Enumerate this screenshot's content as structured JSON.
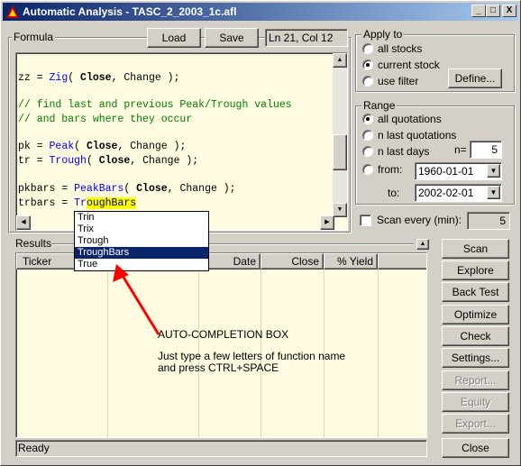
{
  "window": {
    "title": "Automatic Analysis - TASC_2_2003_1c.afl",
    "minimize": "_",
    "maximize": "□",
    "close": "X"
  },
  "formula": {
    "label": "Formula",
    "load_label": "Load",
    "save_label": "Save",
    "position": "Ln 21, Col 12"
  },
  "code": {
    "line1_pre": "zz = ",
    "line1_fn": "Zig",
    "line1_mid": "( ",
    "line1_arg1": "Close",
    "line1_post": ", Change );",
    "comment1": "// find last and previous Peak/Trough values",
    "comment2": "// and bars where they occur",
    "line4_pre": "pk = ",
    "line4_fn": "Peak",
    "line4_mid": "( ",
    "line4_arg1": "Close",
    "line4_post": ", Change );",
    "line5_pre": "tr = ",
    "line5_fn": "Trough",
    "line5_mid": "( ",
    "line5_arg1": "Close",
    "line5_post": ", Change );",
    "line6_pre": "pkbars = ",
    "line6_fn": "PeakBars",
    "line6_mid": "( ",
    "line6_arg1": "Close",
    "line6_post": ", Change );",
    "line7_pre": "trbars = ",
    "line7_typed": "Tr",
    "line7_sel": "oughBars"
  },
  "autocomplete": {
    "items": [
      "Trin",
      "Trix",
      "Trough",
      "TroughBars",
      "True"
    ],
    "selected_index": 3
  },
  "apply_to": {
    "title": "Apply to",
    "all_stocks": "all stocks",
    "current_stock": "current stock",
    "use_filter": "use filter",
    "define_label": "Define...",
    "selected": "current_stock"
  },
  "range": {
    "title": "Range",
    "all_quotations": "all quotations",
    "n_last_quotations": "n last quotations",
    "n_last_days": "n last days",
    "n_label": "n=",
    "n_value": "5",
    "from_label": "from:",
    "from_value": "1960-01-01",
    "to_label": "to:",
    "to_value": "2002-02-01",
    "selected": "all_quotations"
  },
  "scan_every": {
    "label": "Scan every (min):",
    "value": "5",
    "checked": false
  },
  "results": {
    "label": "Results",
    "columns": [
      "Ticker",
      "Date",
      "Close",
      "% Yield"
    ]
  },
  "actions": {
    "scan": "Scan",
    "explore": "Explore",
    "back_test": "Back Test",
    "optimize": "Optimize",
    "check": "Check",
    "settings": "Settings...",
    "report": "Report...",
    "equity": "Equity",
    "export": "Export...",
    "close": "Close"
  },
  "status": {
    "text": "Ready"
  },
  "annotation": {
    "heading": "AUTO-COMPLETION BOX",
    "line1": "Just type a few letters of function name",
    "line2": "and press CTRL+SPACE",
    "arrow_color": "#ff0000"
  },
  "colors": {
    "titlebar_start": "#0a246a",
    "titlebar_end": "#a6caf0",
    "editor_bg": "#fffbe0",
    "keyword": "#0000ff",
    "comment": "#008000",
    "face": "#d4d0c8"
  }
}
